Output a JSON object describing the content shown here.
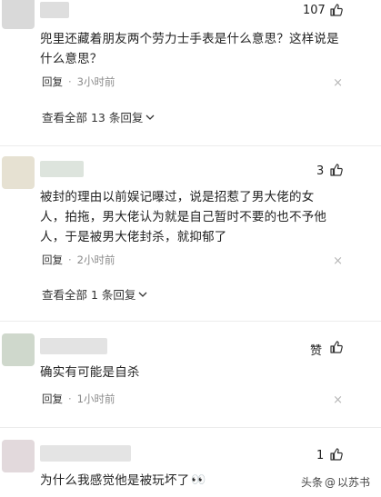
{
  "comments": [
    {
      "avatar_color": "#d9d9d9",
      "likes": "107",
      "text": "兜里还藏着朋友两个劳力士手表是什么意思？这样说是什么意思？",
      "reply_label": "回复",
      "time": "3小时前",
      "close_glyph": "×",
      "view_all": "查看全部 13 条回复"
    },
    {
      "avatar_color": "#e6e1d2",
      "likes": "3",
      "text": "被封的理由以前娱记曝过，说是招惹了男大佬的女人，拍拖，男大佬认为就是自己暂时不要的也不予他人，于是被男大佬封杀，就抑郁了",
      "reply_label": "回复",
      "time": "2小时前",
      "close_glyph": "×",
      "view_all": "查看全部 1 条回复"
    },
    {
      "avatar_color": "#cfd8cc",
      "likes": "赞",
      "text": "确实有可能是自杀",
      "reply_label": "回复",
      "time": "1小时前",
      "close_glyph": "×"
    },
    {
      "avatar_color": "#e2d9dc",
      "likes": "1",
      "text": "为什么我感觉他是被玩坏了",
      "emoji": "👀"
    }
  ],
  "watermark": {
    "platform": "头条",
    "separator": "@",
    "author": "以苏书"
  },
  "icons": {
    "like": "thumbs-up-icon",
    "close": "close-icon",
    "chevron": "chevron-down-icon"
  }
}
